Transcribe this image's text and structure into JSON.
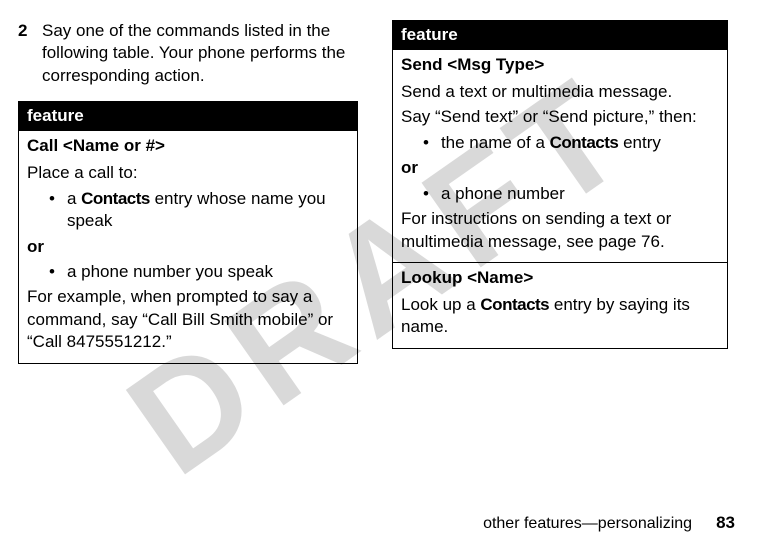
{
  "watermark": "DRAFT",
  "step": {
    "num": "2",
    "text": "Say one of the commands listed in the following table. Your phone performs the corresponding action."
  },
  "left_table": {
    "header": "feature",
    "rows": [
      {
        "title": "Call <Name or #>",
        "intro": "Place a call to:",
        "bullets": [
          {
            "pre": "a ",
            "bold": "Contacts",
            "post": " entry whose name you speak"
          },
          {
            "text": "a phone number you speak"
          }
        ],
        "or": "or",
        "example": "For example, when prompted to say a command, say “Call Bill Smith mobile” or “Call 8475551212.”"
      }
    ]
  },
  "right_table": {
    "header": "feature",
    "rows": [
      {
        "title": "Send <Msg Type>",
        "line1": "Send a text or multimedia message.",
        "line2": "Say “Send text” or “Send picture,” then:",
        "bullets": [
          {
            "pre": "the name of a ",
            "bold": "Contacts",
            "post": " entry"
          },
          {
            "text": "a phone number"
          }
        ],
        "or": "or",
        "after_pre": "For instructions on sending a text or multimedia message, see page ",
        "after_page": "76",
        "after_post": "."
      },
      {
        "title": "Lookup <Name>",
        "line_pre": "Look up a ",
        "line_bold": "Contacts",
        "line_post": " entry by saying its name."
      }
    ]
  },
  "footer": {
    "section": "other features—personalizing",
    "page": "83"
  }
}
